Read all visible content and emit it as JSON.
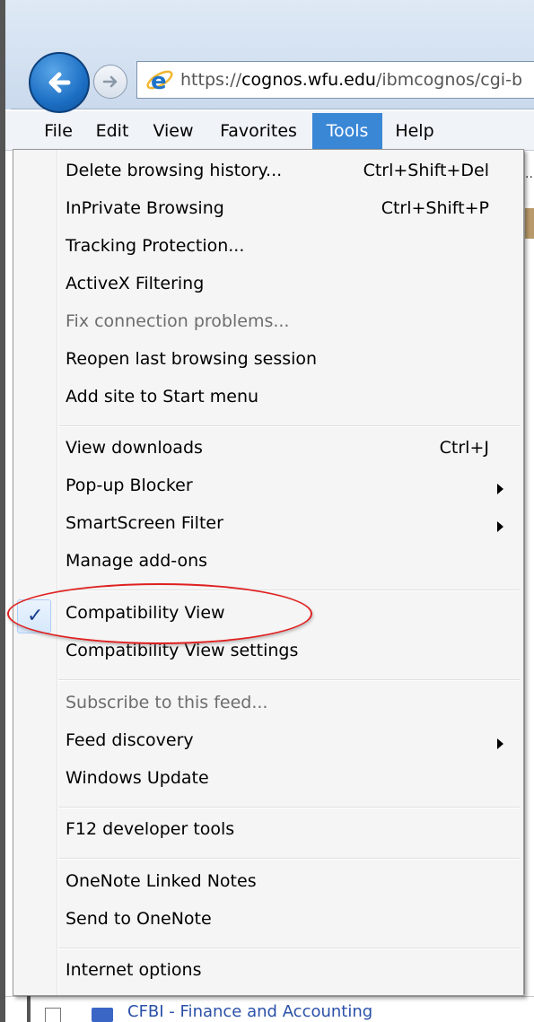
{
  "address_bar": {
    "url_prefix": "https://",
    "url_host": "cognos.wfu.edu",
    "url_path": "/ibmcognos/cgi-b"
  },
  "menubar": {
    "items": [
      {
        "label": "File"
      },
      {
        "label": "Edit"
      },
      {
        "label": "View"
      },
      {
        "label": "Favorites"
      },
      {
        "label": "Tools",
        "active": true
      },
      {
        "label": "Help"
      }
    ]
  },
  "tools_menu": {
    "groups": [
      {
        "items": [
          {
            "label": "Delete browsing history...",
            "shortcut": "Ctrl+Shift+Del"
          },
          {
            "label": "InPrivate Browsing",
            "shortcut": "Ctrl+Shift+P"
          },
          {
            "label": "Tracking Protection..."
          },
          {
            "label": "ActiveX Filtering"
          },
          {
            "label": "Fix connection problems...",
            "disabled": true
          },
          {
            "label": "Reopen last browsing session"
          },
          {
            "label": "Add site to Start menu"
          }
        ]
      },
      {
        "items": [
          {
            "label": "View downloads",
            "shortcut": "Ctrl+J"
          },
          {
            "label": "Pop-up Blocker",
            "submenu": true
          },
          {
            "label": "SmartScreen Filter",
            "submenu": true
          },
          {
            "label": "Manage add-ons"
          }
        ]
      },
      {
        "items": [
          {
            "label": "Compatibility View",
            "checked": true,
            "highlighted": true
          },
          {
            "label": "Compatibility View settings"
          }
        ]
      },
      {
        "items": [
          {
            "label": "Subscribe to this feed...",
            "disabled": true
          },
          {
            "label": "Feed discovery",
            "submenu": true
          },
          {
            "label": "Windows Update"
          }
        ]
      },
      {
        "items": [
          {
            "label": "F12 developer tools"
          }
        ]
      },
      {
        "items": [
          {
            "label": "OneNote Linked Notes"
          },
          {
            "label": "Send to OneNote"
          }
        ]
      },
      {
        "items": [
          {
            "label": "Internet options"
          }
        ]
      }
    ]
  },
  "background": {
    "ellipsis": "...",
    "bottom_link": "CFBI - Finance and Accounting"
  },
  "colors": {
    "menu_highlight": "#3a87d6",
    "annotation": "#e02020",
    "checkmark": "#1b3f8e",
    "disabled_text": "#6d6d6d"
  }
}
